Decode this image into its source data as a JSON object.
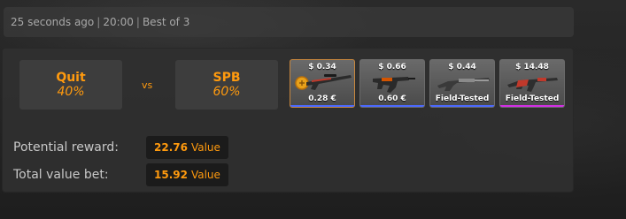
{
  "header": {
    "time_ago": "25 seconds ago",
    "separator": "|",
    "match_time": "20:00",
    "format": "Best of 3"
  },
  "match": {
    "team1": {
      "name": "Quit",
      "percent": "40%"
    },
    "vs_label": "vs",
    "team2": {
      "name": "SPB",
      "percent": "60%"
    }
  },
  "items": [
    {
      "price": "$ 0.34",
      "label": "0.28 €",
      "weapon": "sniper-rifle-icon",
      "rarity_color": "#4b69ff",
      "selected": true
    },
    {
      "price": "$ 0.66",
      "label": "0.60 €",
      "weapon": "smg-icon",
      "rarity_color": "#4b69ff",
      "selected": false
    },
    {
      "price": "$ 0.44",
      "label": "Field-Tested",
      "weapon": "shotgun-icon",
      "rarity_color": "#4b69ff",
      "selected": false
    },
    {
      "price": "$ 14.48",
      "label": "Field-Tested",
      "weapon": "rifle-icon",
      "rarity_color": "#d32ee6",
      "selected": false
    }
  ],
  "rewards": {
    "potential_label": "Potential reward:",
    "potential_value": "22.76",
    "total_label": "Total value bet:",
    "total_value": "15.92",
    "unit": "Value"
  },
  "colors": {
    "accent": "#ff9a0e",
    "label_text": "#c8c8c8",
    "header_text": "#a8a8a8"
  }
}
